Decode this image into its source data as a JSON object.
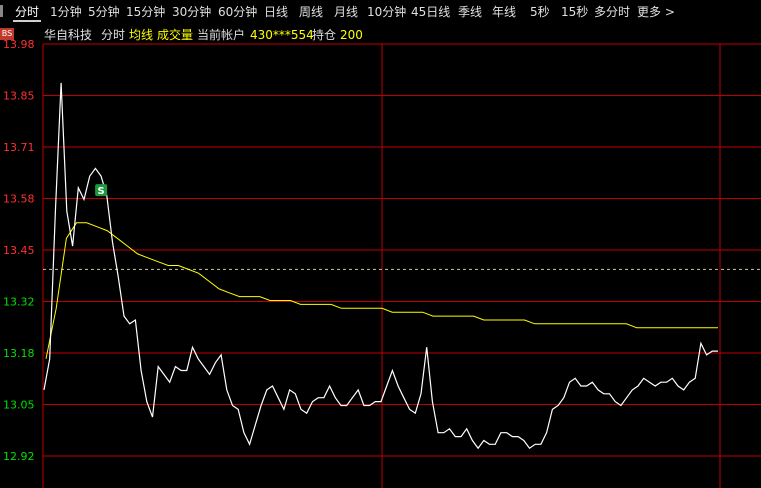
{
  "toolbar": {
    "items": [
      "分时",
      "1分钟",
      "5分钟",
      "15分钟",
      "30分钟",
      "60分钟",
      "日线",
      "周线",
      "月线",
      "10分钟",
      "45日线",
      "季线",
      "年线",
      "5秒",
      "15秒",
      "多分时",
      "更多 >"
    ],
    "active_index": 0
  },
  "header": {
    "badge": "BS",
    "stock_name": "华自科技",
    "tab_time": "分时",
    "tab_avg": "均线",
    "tab_volume": "成交量",
    "account_label": "当前帐户",
    "account_number": "430***554",
    "position_label": "持仓",
    "position_value": "200"
  },
  "colors": {
    "background": "#000000",
    "grid": "#c00000",
    "price_line": "#ffffff",
    "avg_line": "#ffff00",
    "ref_line": "#c8c8a0",
    "label_up": "#ff3030",
    "label_down": "#00e000",
    "sell_marker": "#1a9a3a"
  },
  "chart_data": {
    "type": "line",
    "y_axis_labels": [
      "13.98",
      "13.85",
      "13.71",
      "13.58",
      "13.45",
      "13.32",
      "13.18",
      "13.05",
      "12.92"
    ],
    "ylim": [
      12.92,
      13.98
    ],
    "reference_price": 13.4,
    "marker_label": "S",
    "marker_index": 10,
    "series": [
      {
        "key": "price",
        "values": [
          13.09,
          13.17,
          13.55,
          13.88,
          13.55,
          13.46,
          13.61,
          13.58,
          13.64,
          13.66,
          13.64,
          13.59,
          13.47,
          13.38,
          13.28,
          13.26,
          13.27,
          13.14,
          13.06,
          13.02,
          13.15,
          13.13,
          13.11,
          13.15,
          13.14,
          13.14,
          13.2,
          13.17,
          13.15,
          13.13,
          13.16,
          13.18,
          13.09,
          13.05,
          13.04,
          12.98,
          12.95,
          13.0,
          13.05,
          13.09,
          13.1,
          13.07,
          13.04,
          13.09,
          13.08,
          13.04,
          13.03,
          13.06,
          13.07,
          13.07,
          13.1,
          13.07,
          13.05,
          13.05,
          13.07,
          13.09,
          13.05,
          13.05,
          13.06,
          13.06,
          13.1,
          13.14,
          13.1,
          13.07,
          13.04,
          13.03,
          13.08,
          13.2,
          13.06,
          12.98,
          12.98,
          12.99,
          12.97,
          12.97,
          12.99,
          12.96,
          12.94,
          12.96,
          12.95,
          12.95,
          12.98,
          12.98,
          12.97,
          12.97,
          12.96,
          12.94,
          12.95,
          12.95,
          12.98,
          13.04,
          13.05,
          13.07,
          13.11,
          13.12,
          13.1,
          13.1,
          13.11,
          13.09,
          13.08,
          13.08,
          13.06,
          13.05,
          13.07,
          13.09,
          13.1,
          13.12,
          13.11,
          13.1,
          13.11,
          13.11,
          13.12,
          13.1,
          13.09,
          13.11,
          13.12,
          13.21,
          13.18,
          13.19,
          13.19
        ],
        "color": "#ffffff"
      },
      {
        "key": "average",
        "values": [
          13.17,
          13.3,
          13.48,
          13.52,
          13.52,
          13.51,
          13.5,
          13.48,
          13.46,
          13.44,
          13.43,
          13.42,
          13.41,
          13.41,
          13.4,
          13.39,
          13.37,
          13.35,
          13.34,
          13.33,
          13.33,
          13.33,
          13.32,
          13.32,
          13.32,
          13.31,
          13.31,
          13.31,
          13.31,
          13.3,
          13.3,
          13.3,
          13.3,
          13.3,
          13.29,
          13.29,
          13.29,
          13.29,
          13.28,
          13.28,
          13.28,
          13.28,
          13.28,
          13.27,
          13.27,
          13.27,
          13.27,
          13.27,
          13.26,
          13.26,
          13.26,
          13.26,
          13.26,
          13.26,
          13.26,
          13.26,
          13.26,
          13.26,
          13.25,
          13.25,
          13.25,
          13.25,
          13.25,
          13.25,
          13.25,
          13.25,
          13.25
        ],
        "color": "#ffff00"
      }
    ]
  }
}
